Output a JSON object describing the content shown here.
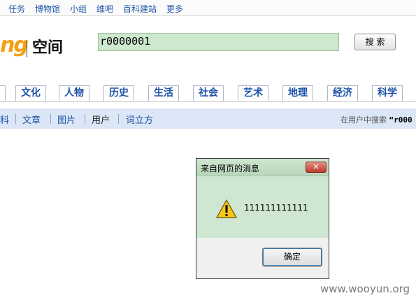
{
  "topnav": [
    "任务",
    "博物馆",
    "小组",
    "维吧",
    "百科建站",
    "更多"
  ],
  "logo": {
    "mark": "ng",
    "text": "空间"
  },
  "search": {
    "value": "r0000001",
    "button": "搜 索"
  },
  "categories": [
    "文化",
    "人物",
    "历史",
    "生活",
    "社会",
    "艺术",
    "地理",
    "经济",
    "科学"
  ],
  "subtabs": [
    "科",
    "文章",
    "图片",
    "用户",
    "词立方"
  ],
  "subtabs_active": "用户",
  "search_in": {
    "label": "在用户中搜索",
    "query": "“r000"
  },
  "dialog": {
    "title": "来自网页的消息",
    "close": "✕",
    "message": "111111111111",
    "ok": "确定",
    "icon": "warning-icon"
  },
  "watermark": "www.wooyun.org",
  "colors": {
    "link": "#1d52a8",
    "logo": "#f5a012",
    "input_bg": "#cde8cd",
    "dialog_bg": "#cfe7d2"
  }
}
